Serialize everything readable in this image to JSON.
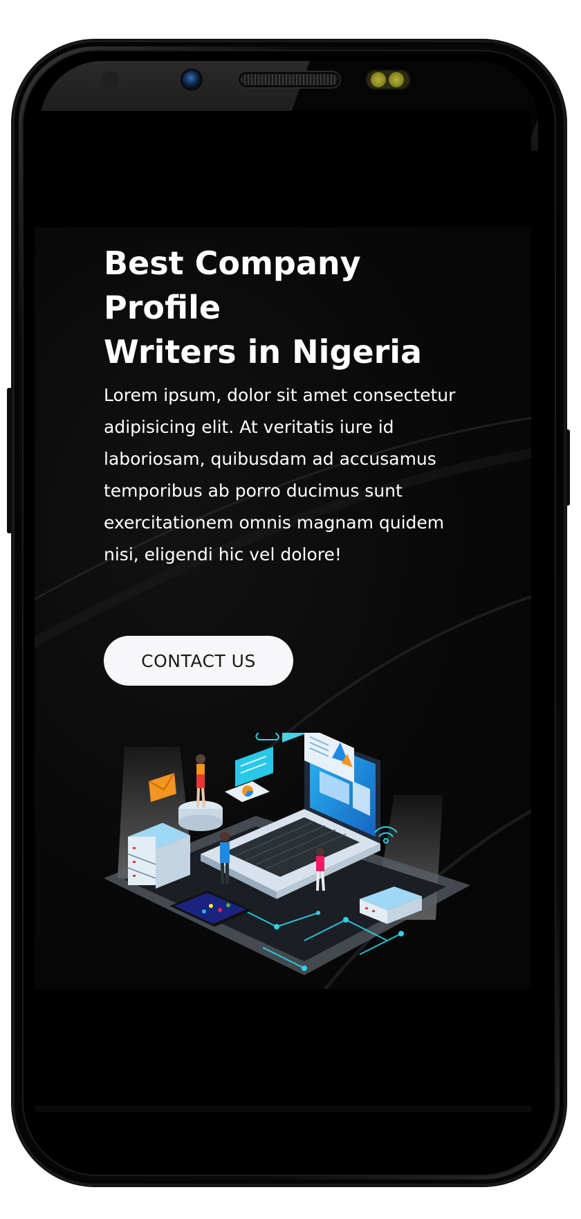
{
  "hero": {
    "title_lines": [
      "Best Company",
      "Profile",
      "Writers in Nigeria"
    ],
    "description": "Lorem ipsum, dolor sit amet consectetur adipisicing elit. At veritatis iure id laboriosam, quibusdam ad accusamus temporibus ab porro ducimus sunt exercitationem omnis magnam quidem nisi, eligendi hic vel dolore!",
    "cta_label": "CONTACT US"
  },
  "illustration": {
    "icon": "isometric-tech-laptop-illustration"
  },
  "colors": {
    "screen_background": "#000000",
    "hero_background": "#080808",
    "text": "#ffffff",
    "button_background": "#f7f7f9",
    "button_text": "#1a1a1a",
    "accent_cyan": "#2fd3e8",
    "accent_blue": "#1e88e5",
    "accent_orange": "#f5941e"
  }
}
